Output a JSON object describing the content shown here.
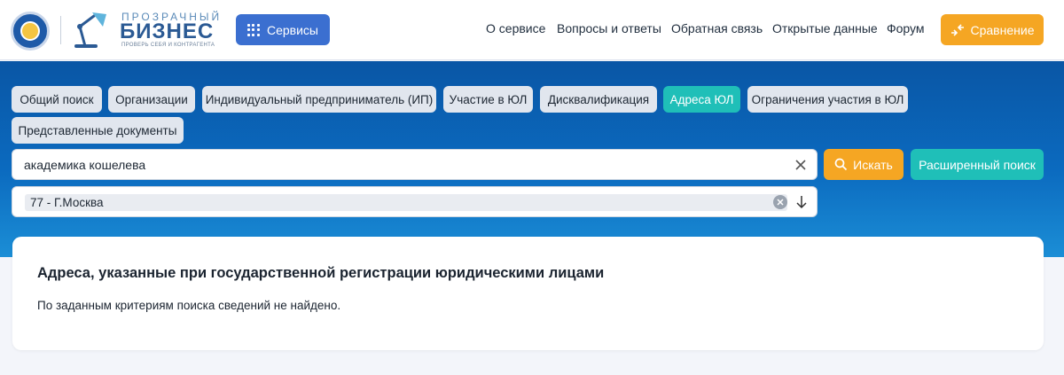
{
  "header": {
    "logo": {
      "top_text": "ПРОЗРАЧНЫЙ",
      "main_text": "БИЗНЕС",
      "sub_text": "ПРОВЕРЬ СЕБЯ И КОНТРАГЕНТА"
    },
    "services_label": "Сервисы",
    "nav": [
      "О сервисе",
      "Вопросы и ответы",
      "Обратная связь",
      "Открытые данные",
      "Форум"
    ],
    "compare_label": "Сравнение"
  },
  "tabs": [
    {
      "label": "Общий поиск",
      "active": false
    },
    {
      "label": "Организации",
      "active": false
    },
    {
      "label": "Индивидуальный предприниматель (ИП)",
      "active": false
    },
    {
      "label": "Участие в ЮЛ",
      "active": false
    },
    {
      "label": "Дисквалификация",
      "active": false
    },
    {
      "label": "Адреса ЮЛ",
      "active": true
    },
    {
      "label": "Ограничения участия в ЮЛ",
      "active": false
    },
    {
      "label": "Представленные документы",
      "active": false
    }
  ],
  "search": {
    "value": "академика кошелева",
    "search_label": "Искать",
    "advanced_label": "Расширенный поиск"
  },
  "region": {
    "selected": "77 - Г.Москва"
  },
  "result": {
    "title": "Адреса, указанные при государственной регистрации юридическими лицами",
    "message": "По заданным критериям поиска сведений не найдено."
  },
  "colors": {
    "primary_blue": "#3b6fd0",
    "accent_orange": "#f5a623",
    "accent_teal": "#1fbfb8",
    "band_blue": "#0b6abf"
  }
}
